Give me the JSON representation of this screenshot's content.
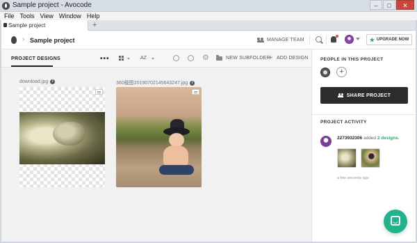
{
  "window": {
    "title": "Sample project - Avocode",
    "controls": [
      "–",
      "□",
      "✕"
    ]
  },
  "menu": [
    "File",
    "Tools",
    "View",
    "Window",
    "Help"
  ],
  "tabs": {
    "active": "Sample project",
    "new_tab": "+"
  },
  "header": {
    "project_name": "Sample project",
    "manage_team": "MANAGE TEAM",
    "upgrade": "UPGRADE NOW",
    "upgrade_star": "★"
  },
  "toolbar": {
    "tab": "PROJECT DESIGNS",
    "more": "•••",
    "sort": "AZ",
    "new_subfolder": "NEW SUBFOLDER",
    "add_design_plus": "+",
    "add_design": "ADD DESIGN"
  },
  "designs": [
    {
      "filename": "download.jpg",
      "info": "i"
    },
    {
      "filename": "360截图20190702145643247.jpg",
      "info": "i"
    }
  ],
  "sidebar": {
    "people_heading": "PEOPLE IN THIS PROJECT",
    "add_member": "+",
    "share_button": "SHARE PROJECT",
    "activity_heading": "PROJECT ACTIVITY",
    "activity": {
      "user": "2273932306",
      "action": " added ",
      "object": "2 designs",
      "suffix": ".",
      "time": "a few seconds ago"
    }
  },
  "colors": {
    "accent_green": "#27ae60",
    "share_button_bg": "#2c2c2c",
    "chat_fab": "#1fb489"
  },
  "icons": [
    "avocode-logo-icon",
    "team-icon",
    "search-icon",
    "bell-icon",
    "avatar",
    "star-icon",
    "grid-icon",
    "refresh-icon",
    "sync-icon",
    "gear-icon",
    "folder-icon",
    "info-icon",
    "comment-icon",
    "share-icon",
    "chat-icon"
  ]
}
